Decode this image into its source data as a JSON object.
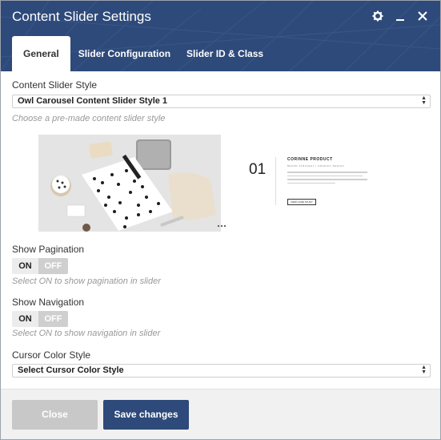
{
  "window": {
    "title": "Content Slider Settings",
    "icons": [
      "gear-icon",
      "minimize-icon",
      "close-icon"
    ]
  },
  "tabs": [
    {
      "label": "General",
      "active": true
    },
    {
      "label": "Slider Configuration",
      "active": false
    },
    {
      "label": "Slider ID & Class",
      "active": false
    }
  ],
  "style_field": {
    "label": "Content Slider Style",
    "value": "Owl Carousel Content Slider Style 1",
    "hint": "Choose a pre-made content slider style"
  },
  "preview": {
    "number": "01",
    "product_title": "CORINNE PRODUCT",
    "product_subtitle": "BRAND STRATEGY | GRAPHIC DESIGN",
    "button_label": "VIEW CASE STUDY"
  },
  "pagination": {
    "label": "Show Pagination",
    "on_label": "ON",
    "off_label": "OFF",
    "hint": "Select ON to show pagination in slider"
  },
  "navigation": {
    "label": "Show Navigation",
    "on_label": "ON",
    "off_label": "OFF",
    "hint": "Select ON to show navigation in slider"
  },
  "cursor_field": {
    "label": "Cursor Color Style",
    "value": "Select Cursor Color Style"
  },
  "footer": {
    "close_label": "Close",
    "save_label": "Save changes"
  },
  "colors": {
    "header": "#2e4a7a",
    "primary_button": "#2e4a7a",
    "disabled_button": "#c8c8c8"
  }
}
